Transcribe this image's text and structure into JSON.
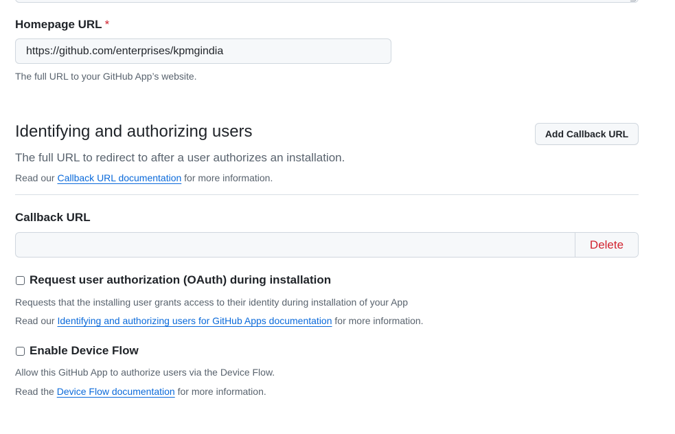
{
  "homepage": {
    "label": "Homepage URL",
    "required_mark": "*",
    "value": "https://github.com/enterprises/kpmgindia",
    "hint": "The full URL to your GitHub App’s website."
  },
  "identifying": {
    "title": "Identifying and authorizing users",
    "lead": "The full URL to redirect to after a user authorizes an installation.",
    "docs_prefix": "Read our",
    "docs_link": "Callback URL documentation",
    "docs_suffix": "for more information.",
    "add_button": "Add Callback URL"
  },
  "callback": {
    "label": "Callback URL",
    "value": "",
    "delete_button": "Delete"
  },
  "oauth": {
    "label": "Request user authorization (OAuth) during installation",
    "checked": false,
    "description": "Requests that the installing user grants access to their identity during installation of your App",
    "docs_prefix": "Read our",
    "docs_link": "Identifying and authorizing users for GitHub Apps documentation",
    "docs_suffix": "for more information."
  },
  "device_flow": {
    "label": "Enable Device Flow",
    "checked": false,
    "description": "Allow this GitHub App to authorize users via the Device Flow.",
    "docs_prefix": "Read the",
    "docs_link": "Device Flow documentation",
    "docs_suffix": "for more information."
  }
}
